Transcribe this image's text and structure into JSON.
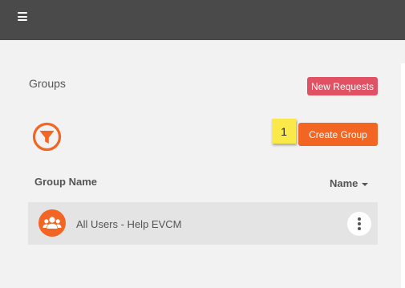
{
  "header": {
    "menu_icon": "hamburger-menu-icon"
  },
  "page": {
    "title": "Groups"
  },
  "actions": {
    "new_requests_label": "New Requests",
    "create_group_label": "Create Group",
    "filter_icon": "filter-funnel-icon"
  },
  "step_badge": {
    "number": "1"
  },
  "table": {
    "column_header": "Group Name",
    "sort_label": "Name",
    "sort_icon": "caret-down-icon",
    "rows": [
      {
        "label": "All Users - Help EVCM",
        "icon": "users-group-icon",
        "menu_icon": "vertical-ellipsis-icon"
      }
    ]
  },
  "colors": {
    "topbar": "#4a4a4a",
    "accent_orange": "#f26522",
    "new_requests": "#e05263",
    "badge_yellow": "#fbe94a",
    "row_bg": "#e4e4e4"
  }
}
